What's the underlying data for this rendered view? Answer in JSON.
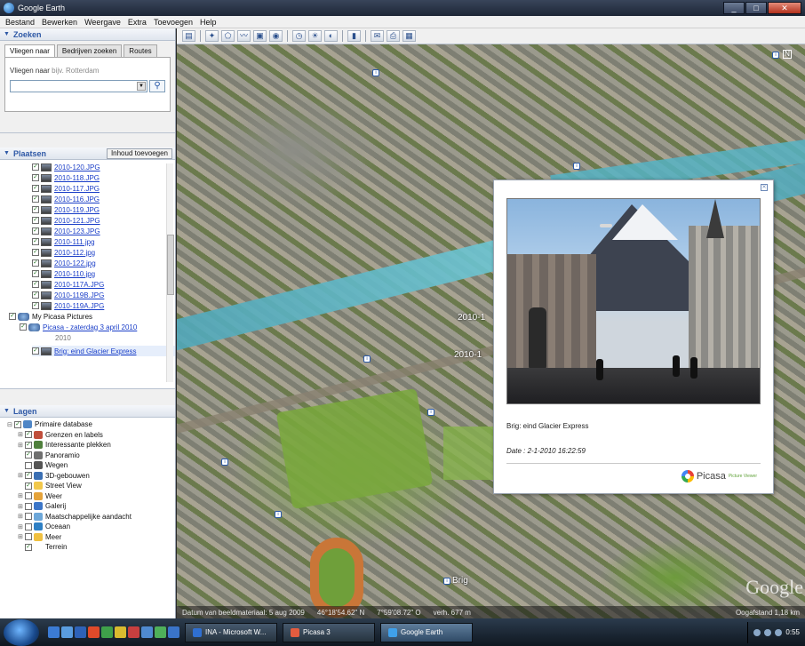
{
  "window": {
    "title": "Google Earth",
    "min": "_",
    "max": "□",
    "close": "✕"
  },
  "menu": [
    "Bestand",
    "Bewerken",
    "Weergave",
    "Extra",
    "Toevoegen",
    "Help"
  ],
  "search": {
    "section_title": "Zoeken",
    "tabs": [
      "Vliegen naar",
      "Bedrijven zoeken",
      "Routes"
    ],
    "active_tab": "Vliegen naar",
    "label": "Vliegen naar",
    "placeholder": "bijv. Rotterdam",
    "value": ""
  },
  "places": {
    "section_title": "Plaatsen",
    "add_button": "Inhoud toevoegen",
    "photos": [
      "2010-120.JPG",
      "2010-118.JPG",
      "2010-117.JPG",
      "2010-116.JPG",
      "2010-119.JPG",
      "2010-121.JPG",
      "2010-123.JPG",
      "2010-111.jpg",
      "2010-112.jpg",
      "2010-122.jpg",
      "2010-110.jpg",
      "2010-117A.JPG",
      "2010-119B.JPG",
      "2010-119A.JPG"
    ],
    "group": "My Picasa Pictures",
    "album": "Picasa - zaterdag 3 april 2010",
    "year": "2010",
    "selected": "Brig: eind Glacier Express"
  },
  "layers": {
    "section_title": "Lagen",
    "items": [
      {
        "label": "Primaire database",
        "color": "#4f86c6",
        "child": false
      },
      {
        "label": "Grenzen en labels",
        "color": "#c04e3b",
        "child": true
      },
      {
        "label": "Interessante plekken",
        "color": "#4f7f3c",
        "child": true
      },
      {
        "label": "Panoramio",
        "color": "#6f6f6f",
        "child": true
      },
      {
        "label": "Wegen",
        "color": "#555555",
        "child": true
      },
      {
        "label": "3D-gebouwen",
        "color": "#3b6fb3",
        "child": true
      },
      {
        "label": "Street View",
        "color": "#f2c84b",
        "child": true
      },
      {
        "label": "Weer",
        "color": "#e5a33a",
        "child": true
      },
      {
        "label": "Galerij",
        "color": "#3c76c8",
        "child": true
      },
      {
        "label": "Maatschappelijke aandacht",
        "color": "#6da7d9",
        "child": true
      },
      {
        "label": "Oceaan",
        "color": "#2e7fc4",
        "child": true
      },
      {
        "label": "Meer",
        "color": "#f0c040",
        "child": true
      },
      {
        "label": "Terrein",
        "color": "#ffffff",
        "child": true
      }
    ]
  },
  "map": {
    "labels": [
      "2010-1",
      "2010-1",
      "Brig"
    ],
    "watermark": "Google",
    "status_left": "Datum van beeldmateriaal: 5 aug 2009",
    "status_lat": "46°18'54.62\" N",
    "status_lon": "7°59'08.72\" O",
    "status_elev": "verh. 677 m",
    "status_right": "Oogafstand 1,18 km"
  },
  "popup": {
    "caption": "Brig: eind Glacier Express",
    "date": "Date : 2-1-2010 16:22:59",
    "brand": "Picasa",
    "brand_sub": "Picture Viewer"
  },
  "taskbar": {
    "tasks": [
      {
        "label": "INA - Microsoft W...",
        "color": "#2f6fd0"
      },
      {
        "label": "Picasa 3",
        "color": "#e35c3f"
      },
      {
        "label": "Google Earth",
        "color": "#3fa0ea"
      }
    ],
    "clock": "0:55"
  }
}
